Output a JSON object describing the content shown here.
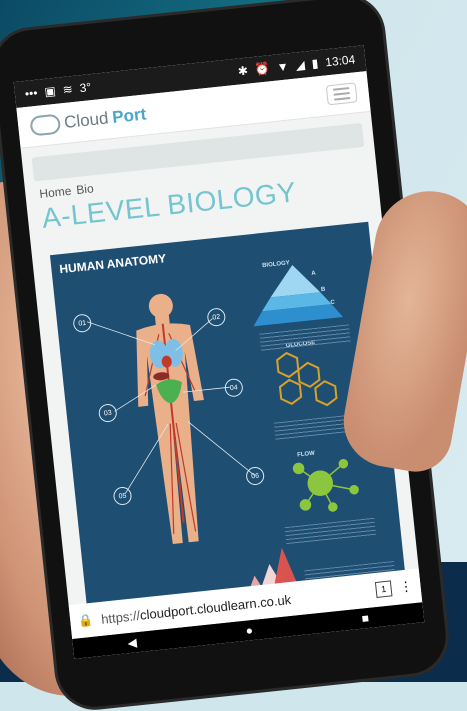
{
  "status": {
    "left_icons": [
      "more-dots-icon",
      "image-icon",
      "drive-icon"
    ],
    "temperature": "3°",
    "right_icons": [
      "bluetooth-icon",
      "alarm-icon",
      "wifi-icon",
      "signal-icon",
      "battery-icon"
    ],
    "time": "13:04"
  },
  "app": {
    "logo_cloud": "Cloud",
    "logo_port": "Port"
  },
  "breadcrumb": {
    "items": [
      "Home",
      "Bio"
    ]
  },
  "page": {
    "title": "A-LEVEL BIOLOGY"
  },
  "poster": {
    "title": "HUMAN ANATOMY",
    "labels": {
      "pyramid": "BIOLOGY",
      "hexagons": "GLUCOSE",
      "network": "FLOW",
      "a": "A",
      "b": "B",
      "c": "C"
    },
    "numbers": [
      "01",
      "02",
      "03",
      "04",
      "05",
      "06"
    ],
    "colors": {
      "background": "#1f4e73",
      "accent_blue": "#5bb7e5",
      "accent_orange": "#d8a12b",
      "accent_green": "#8cc63f",
      "accent_red": "#d9534f"
    }
  },
  "browser": {
    "url_scheme": "https://",
    "url_host": "cloudport.cloudlearn.co.uk",
    "tab_count": "1"
  }
}
